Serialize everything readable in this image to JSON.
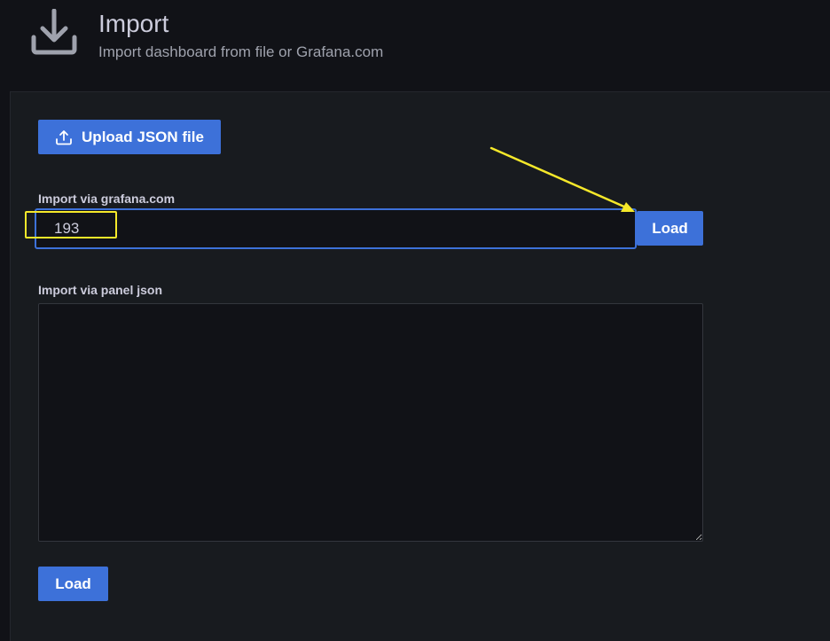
{
  "header": {
    "title": "Import",
    "subtitle": "Import dashboard from file or Grafana.com",
    "icon": "download-icon"
  },
  "upload": {
    "label": "Upload JSON file",
    "icon": "upload-icon"
  },
  "grafana_com": {
    "label": "Import via grafana.com",
    "value": "193",
    "load_label": "Load"
  },
  "panel_json": {
    "label": "Import via panel json",
    "value": "",
    "load_label": "Load"
  },
  "colors": {
    "background": "#111217",
    "panel": "#181b1f",
    "primary_button": "#3d71d9",
    "text": "#ccccdc",
    "annotation": "#f5e82a"
  }
}
